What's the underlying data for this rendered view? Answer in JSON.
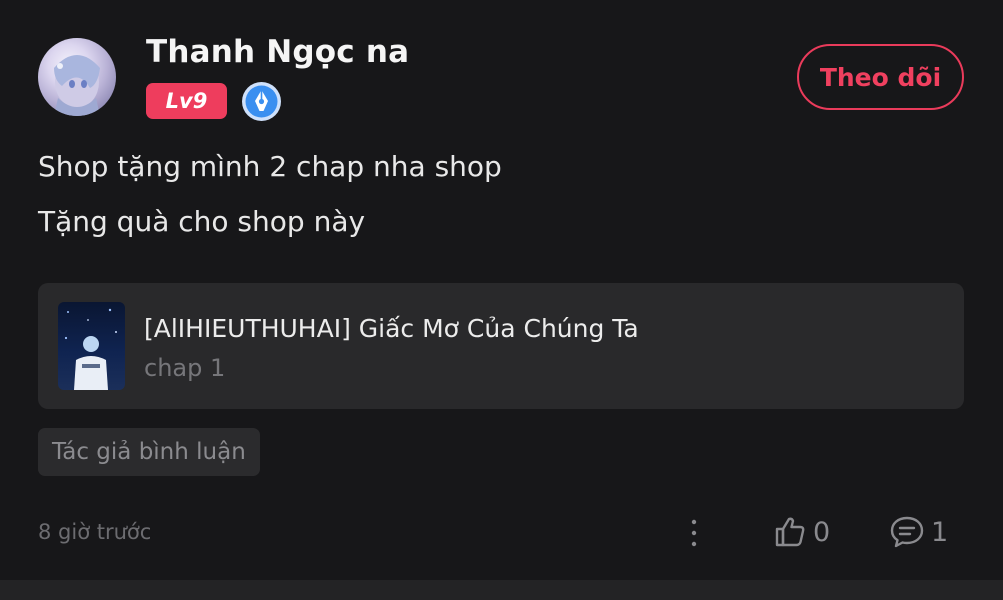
{
  "user": {
    "name": "Thanh Ngọc na",
    "level": "Lv9"
  },
  "follow_label": "Theo dõi",
  "post": {
    "lines": [
      "Shop tặng mình 2 chap nha shop",
      "Tặng quà cho shop này"
    ]
  },
  "gift": {
    "title": "[AlIHIEUTHUHAI] Giấc Mơ Của Chúng Ta",
    "subtitle": "chap 1"
  },
  "author_tag": "Tác giả bình luận",
  "footer": {
    "timestamp": "8 giờ trước",
    "likes": "0",
    "comments": "1"
  },
  "colors": {
    "background": "#171719",
    "accent": "#ee3d5d",
    "badge_blue": "#3a8ff0"
  },
  "icons": [
    "avatar-image",
    "author-pen-badge-icon",
    "more-vertical-icon",
    "thumbs-up-icon",
    "comment-icon"
  ]
}
